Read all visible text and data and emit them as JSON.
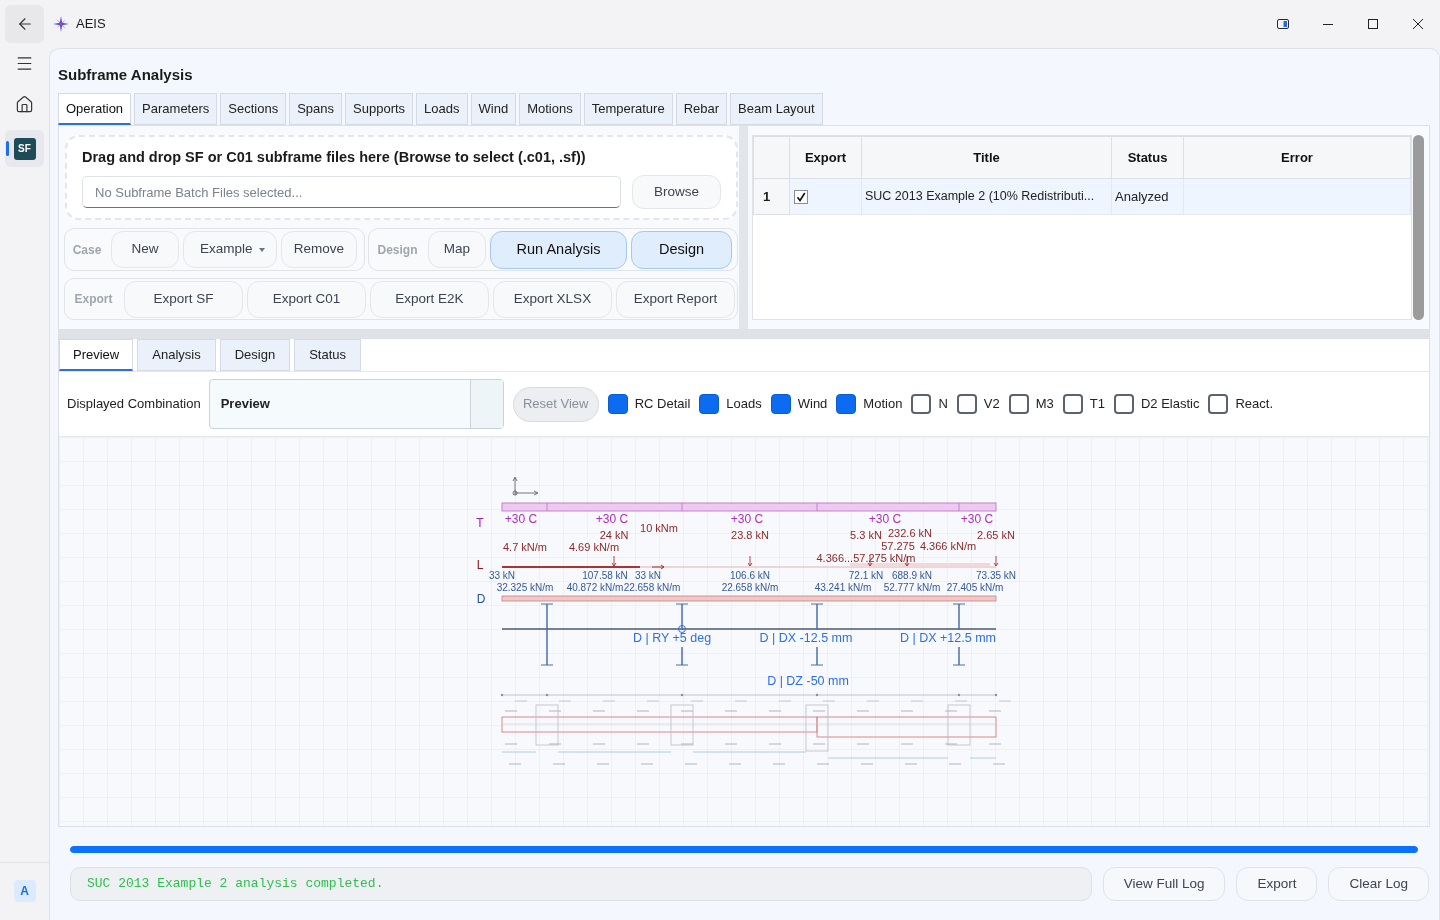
{
  "window": {
    "title": "AEIS"
  },
  "sidebar": {
    "items": [
      {
        "kind": "home",
        "selected": false
      },
      {
        "kind": "app",
        "label": "SF",
        "selected": true
      }
    ],
    "account": {
      "label": "A"
    }
  },
  "page": {
    "title": "Subframe Analysis"
  },
  "tabs": [
    {
      "label": "Operation",
      "selected": true
    },
    {
      "label": "Parameters",
      "selected": false
    },
    {
      "label": "Sections",
      "selected": false
    },
    {
      "label": "Spans",
      "selected": false
    },
    {
      "label": "Supports",
      "selected": false
    },
    {
      "label": "Loads",
      "selected": false
    },
    {
      "label": "Wind",
      "selected": false
    },
    {
      "label": "Motions",
      "selected": false
    },
    {
      "label": "Temperature",
      "selected": false
    },
    {
      "label": "Rebar",
      "selected": false
    },
    {
      "label": "Beam Layout",
      "selected": false
    }
  ],
  "file_panel": {
    "heading": "Drag and drop SF or C01 subframe files here (Browse to select (.c01, .sf))",
    "file_field": {
      "placeholder": "No Subframe Batch Files selected..."
    },
    "browse_button": "Browse"
  },
  "action_groups": [
    {
      "label": "Case",
      "buttons": [
        {
          "label": "New",
          "kind": "plain"
        },
        {
          "label": "Example",
          "kind": "dropdown"
        },
        {
          "label": "Remove",
          "kind": "plain"
        }
      ]
    },
    {
      "label": "Design",
      "buttons": [
        {
          "label": "Map",
          "kind": "plain"
        },
        {
          "label": "Run Analysis",
          "kind": "primary"
        },
        {
          "label": "Design",
          "kind": "primary"
        }
      ]
    },
    {
      "label": "Export",
      "buttons": [
        {
          "label": "Export SF",
          "kind": "plain"
        },
        {
          "label": "Export C01",
          "kind": "plain"
        },
        {
          "label": "Export E2K",
          "kind": "plain"
        },
        {
          "label": "Export XLSX",
          "kind": "plain"
        },
        {
          "label": "Export Report",
          "kind": "plain"
        }
      ]
    }
  ],
  "batch_table": {
    "columns": [
      "Export",
      "Title",
      "Status",
      "Error"
    ],
    "rows": [
      {
        "number": "1",
        "export": true,
        "title": "SUC 2013 Example 2 (10% Redistributi...",
        "status": "Analyzed",
        "selected": true
      }
    ]
  },
  "result_tabs": [
    {
      "label": "Preview",
      "selected": true
    },
    {
      "label": "Analysis",
      "selected": false
    },
    {
      "label": "Design",
      "selected": false
    },
    {
      "label": "Status",
      "selected": false
    }
  ],
  "preview_toolbar": {
    "combination_label": "Displayed Combination",
    "combination": {
      "value": "Preview"
    },
    "reset_button": {
      "label": "Reset View",
      "disabled": true
    },
    "toggles": [
      {
        "label": "RC Detail",
        "checked": true
      },
      {
        "label": "Loads",
        "checked": true
      },
      {
        "label": "Wind",
        "checked": true
      },
      {
        "label": "Motion",
        "checked": true
      },
      {
        "label": "N",
        "checked": false
      },
      {
        "label": "V2",
        "checked": false
      },
      {
        "label": "M3",
        "checked": false
      },
      {
        "label": "T1",
        "checked": false
      },
      {
        "label": "D2 Elastic",
        "checked": false
      },
      {
        "label": "React.",
        "checked": false
      }
    ]
  },
  "diagram": {
    "row_labels": [
      {
        "text": "T",
        "color": "#a020b0"
      },
      {
        "text": "L",
        "color": "#8b1a1a"
      },
      {
        "text": "D",
        "color": "#2a4f9a"
      }
    ],
    "temperature_labels": [
      "+30 C",
      "+30 C",
      "+30 C",
      "+30 C",
      "+30 C"
    ],
    "load_labels": [
      "24 kN",
      "10 kNm",
      "23.8 kN",
      "5.3 kN",
      "232.6 kN",
      "2.65 kN",
      "4.7 kN/m",
      "4.69 kN/m",
      "57.275",
      "4.366 kN/m",
      "4.366...57.275 kN/m"
    ],
    "dead_load_labels": [
      "33 kN",
      "107.58 kN",
      "33 kN",
      "106.6 kN",
      "72.1 kN",
      "688.9 kN",
      "73.35 kN",
      "32.325 kN/m",
      "40.872 kN/m",
      "22.658 kN/m",
      "22.658 kN/m",
      "43.241 kN/m",
      "52.777 kN/m",
      "27.405 kN/m"
    ],
    "displacement_labels": [
      "D | RY +5 deg",
      "D | DX -12.5 mm",
      "D | DX +12.5 mm",
      "D | DZ -50 mm"
    ]
  },
  "progress": {
    "level": 1
  },
  "log": {
    "message": "SUC 2013 Example 2 analysis completed.",
    "buttons": [
      "View Full Log",
      "Export",
      "Clear Log"
    ]
  }
}
